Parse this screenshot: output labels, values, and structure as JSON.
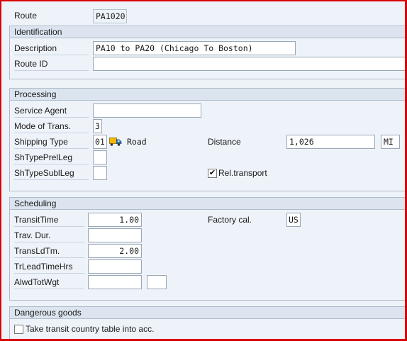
{
  "header": {
    "route_label": "Route",
    "route_value": "PA1020"
  },
  "identification": {
    "title": "Identification",
    "description_label": "Description",
    "description_value": "PA10 to PA20 (Chicago To Boston)",
    "route_id_label": "Route ID",
    "route_id_value": ""
  },
  "processing": {
    "title": "Processing",
    "service_agent_label": "Service Agent",
    "service_agent_value": "",
    "mode_label": "Mode of Trans.",
    "mode_value": "3",
    "shipping_type_label": "Shipping Type",
    "shipping_type_value": "01",
    "shipping_type_icon": "truck-icon",
    "shipping_type_text": "Road",
    "distance_label": "Distance",
    "distance_value": "1,026",
    "distance_unit": "MI",
    "sh_pre_label": "ShTypePrelLeg",
    "sh_pre_value": "",
    "sh_sub_label": "ShTypeSublLeg",
    "sh_sub_value": "",
    "rel_transport_label": "Rel.transport",
    "rel_transport_checked": true
  },
  "scheduling": {
    "title": "Scheduling",
    "transit_time_label": "TransitTime",
    "transit_time_value": "1.00",
    "factory_cal_label": "Factory cal.",
    "factory_cal_value": "US",
    "trav_dur_label": "Trav. Dur.",
    "trav_dur_value": "",
    "transld_label": "TransLdTm.",
    "transld_value": "2.00",
    "trlead_label": "TrLeadTimeHrs",
    "trlead_value": "",
    "alwd_label": "AlwdTotWgt",
    "alwd_value": "",
    "alwd_unit": ""
  },
  "dangerous_goods": {
    "title": "Dangerous goods",
    "transit_country_label": "Take transit country table into acc.",
    "transit_country_checked": false
  },
  "colors": {
    "frame": "#d80000",
    "background": "#eef3f9",
    "group_header": "#dce5ef"
  }
}
